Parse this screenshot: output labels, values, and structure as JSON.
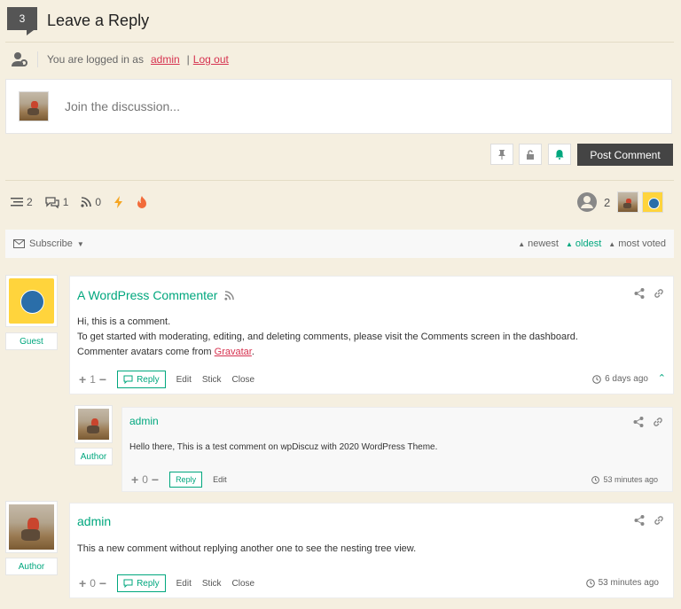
{
  "header": {
    "count": "3",
    "title": "Leave a Reply"
  },
  "login": {
    "prefix": "You are logged in as",
    "user": "admin",
    "sep": "|",
    "logout": "Log out"
  },
  "reply_box": {
    "placeholder": "Join the discussion..."
  },
  "toolbar": {
    "post_label": "Post Comment"
  },
  "stats": {
    "threads": "2",
    "replies": "1",
    "followers": "0",
    "participants": "2"
  },
  "subscribe": {
    "label": "Subscribe",
    "sort": [
      "newest",
      "oldest",
      "most voted"
    ]
  },
  "comments": [
    {
      "author": "A WordPress Commenter",
      "role": "Guest",
      "text": [
        "Hi, this is a comment.",
        "To get started with moderating, editing, and deleting comments, please visit the Comments screen in the dashboard.",
        "Commenter avatars come from"
      ],
      "link": "Gravatar",
      "link_suffix": ".",
      "votes": "1",
      "reply": "Reply",
      "actions": [
        "Edit",
        "Stick",
        "Close"
      ],
      "time": "6 days ago"
    },
    {
      "author": "admin",
      "role": "Author",
      "text": "Hello there, This is a test comment on wpDiscuz with 2020 WordPress Theme.",
      "votes": "0",
      "reply": "Reply",
      "actions": [
        "Edit"
      ],
      "time": "53 minutes ago"
    },
    {
      "author": "admin",
      "role": "Author",
      "text": "This a new comment without replying another one to see the nesting tree view.",
      "votes": "0",
      "reply": "Reply",
      "actions": [
        "Edit",
        "Stick",
        "Close"
      ],
      "time": "53 minutes ago"
    }
  ],
  "colors": {
    "accent": "#00a77e",
    "link": "#d6324f",
    "background": "#f5efe0",
    "button": "#444444"
  }
}
